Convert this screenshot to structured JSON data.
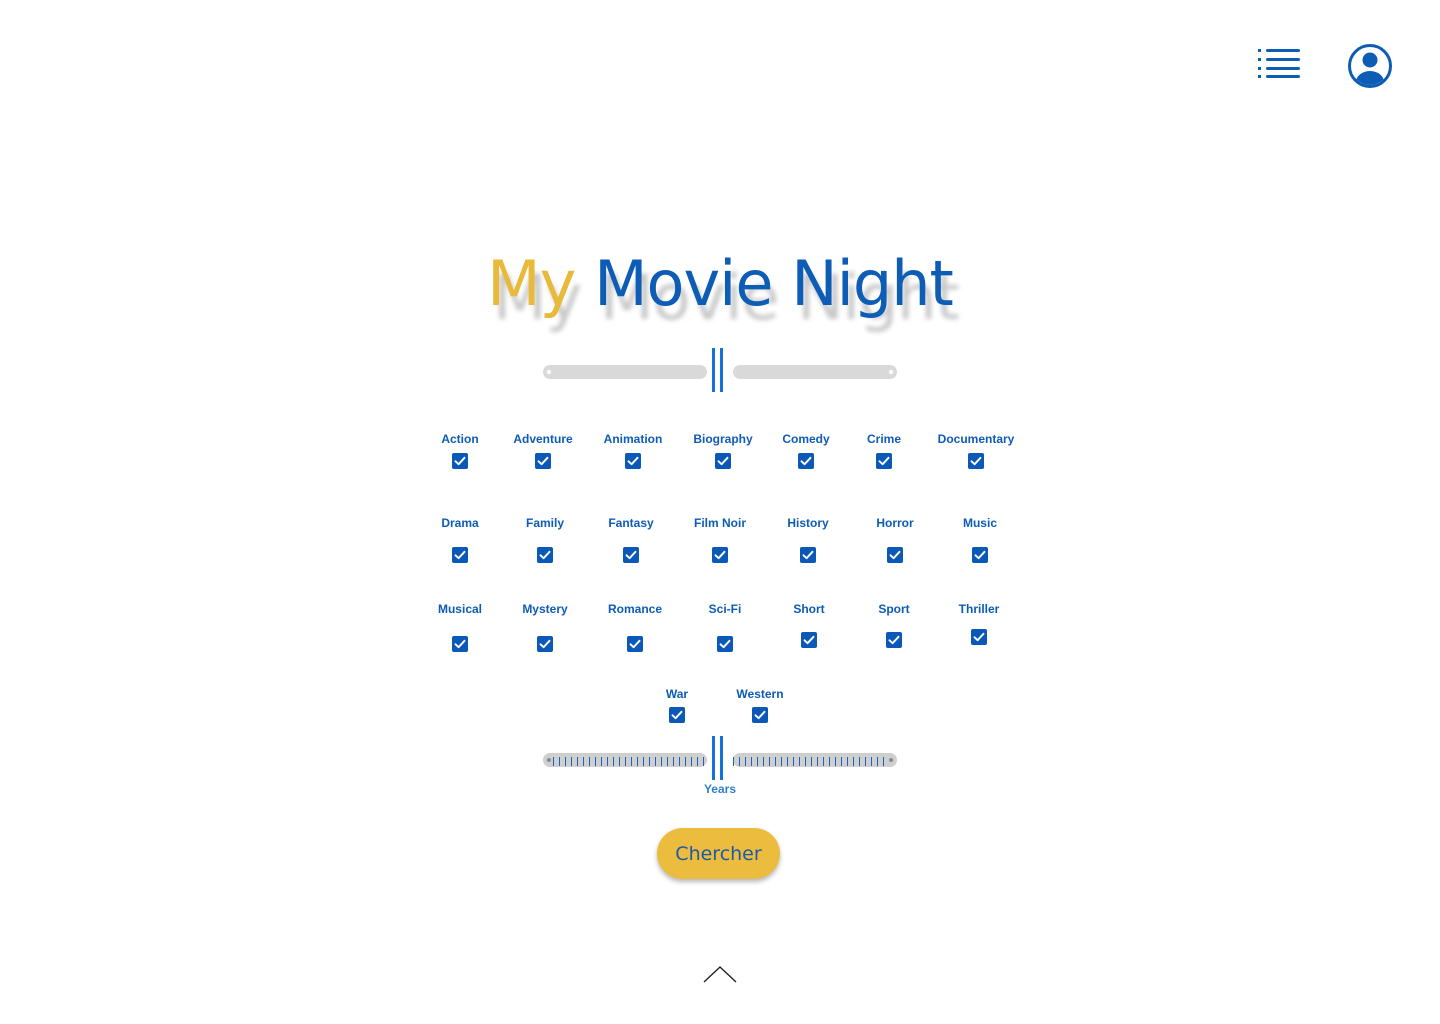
{
  "header": {
    "menu_icon": "list-menu-icon",
    "profile_icon": "user-circle-icon"
  },
  "title": {
    "part1": "My",
    "part2": "Movie Night"
  },
  "colors": {
    "brand_blue": "#0d5cb6",
    "accent_yellow": "#ebbc3e",
    "track_gray": "#d9d9d9"
  },
  "genres": [
    {
      "label": "Action",
      "checked": true
    },
    {
      "label": "Adventure",
      "checked": true
    },
    {
      "label": "Animation",
      "checked": true
    },
    {
      "label": "Biography",
      "checked": true
    },
    {
      "label": "Comedy",
      "checked": true
    },
    {
      "label": "Crime",
      "checked": true
    },
    {
      "label": "Documentary",
      "checked": true
    },
    {
      "label": "Drama",
      "checked": true
    },
    {
      "label": "Family",
      "checked": true
    },
    {
      "label": "Fantasy",
      "checked": true
    },
    {
      "label": "Film Noir",
      "checked": true
    },
    {
      "label": "History",
      "checked": true
    },
    {
      "label": "Horror",
      "checked": true
    },
    {
      "label": "Music",
      "checked": true
    },
    {
      "label": "Musical",
      "checked": true
    },
    {
      "label": "Mystery",
      "checked": true
    },
    {
      "label": "Romance",
      "checked": true
    },
    {
      "label": "Sci-Fi",
      "checked": true
    },
    {
      "label": "Short",
      "checked": true
    },
    {
      "label": "Sport",
      "checked": true
    },
    {
      "label": "Thriller",
      "checked": true
    },
    {
      "label": "War",
      "checked": true
    },
    {
      "label": "Western",
      "checked": true
    }
  ],
  "years_slider": {
    "label": "Years"
  },
  "search": {
    "button_label": "Chercher"
  },
  "footer": {
    "scroll_icon": "chevron-up-icon"
  }
}
